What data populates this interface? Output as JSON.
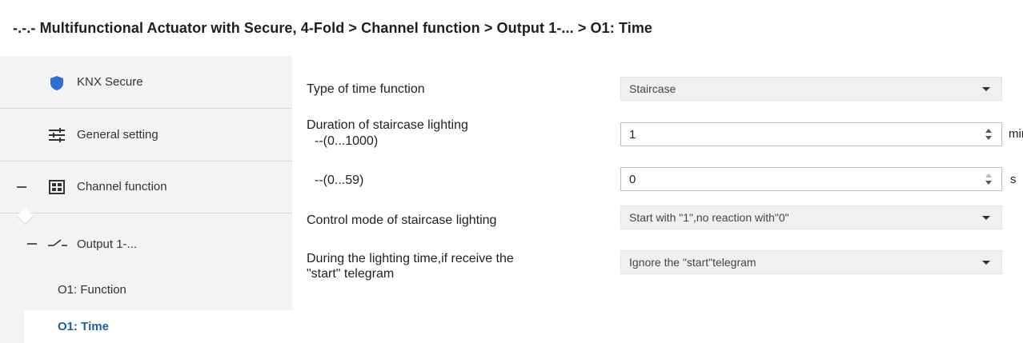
{
  "breadcrumb": "-.-.- Multifunctional Actuator with Secure, 4-Fold > Channel function > Output 1-... > O1: Time",
  "sidebar": {
    "items": [
      {
        "label": "KNX Secure",
        "icon": "shield-icon"
      },
      {
        "label": "General setting",
        "icon": "sliders-icon"
      },
      {
        "label": "Channel function",
        "icon": "grid-icon"
      },
      {
        "label": "Output 1-...",
        "icon": "switch-icon"
      },
      {
        "label": "O1: Function"
      },
      {
        "label": "O1: Time"
      }
    ]
  },
  "main": {
    "type_label": "Type of time function",
    "type_value": "Staircase",
    "duration_label": "Duration of staircase lighting",
    "duration_min_range": "--(0...1000)",
    "duration_min_value": "1",
    "duration_min_unit": "min",
    "duration_s_range": "--(0...59)",
    "duration_s_value": "0",
    "duration_s_unit": "s",
    "control_label": "Control mode of staircase lighting",
    "control_value": "Start with \"1\",no reaction with\"0\"",
    "during_label_line1": "During the lighting time,if receive the",
    "during_label_line2": "\"start\" telegram",
    "during_value": "Ignore the \"start\"telegram"
  },
  "colors": {
    "accent": "#1a5fa8",
    "shield": "#2f6fd1",
    "sidebar_bg": "#f3f3f3",
    "combo_bg": "#f0f0f0"
  }
}
